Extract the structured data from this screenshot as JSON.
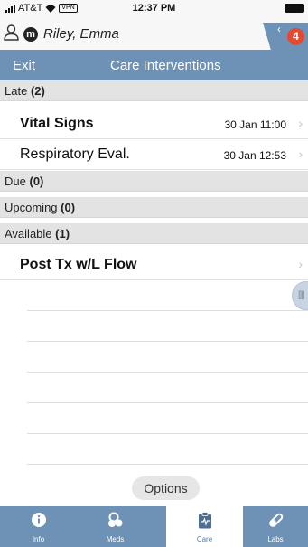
{
  "status_bar": {
    "carrier": "AT&T",
    "vpn": "VPN",
    "time": "12:37 PM"
  },
  "patient": {
    "initial": "m",
    "name": "Riley, Emma",
    "alert_count": "4"
  },
  "nav": {
    "exit_label": "Exit",
    "title": "Care Interventions"
  },
  "sections": {
    "late": {
      "label": "Late",
      "count": "(2)"
    },
    "due": {
      "label": "Due",
      "count": "(0)"
    },
    "upcoming": {
      "label": "Upcoming",
      "count": "(0)"
    },
    "available": {
      "label": "Available",
      "count": "(1)"
    }
  },
  "late_items": [
    {
      "name": "Vital Signs",
      "date": "30 Jan 11:00"
    },
    {
      "name": "Respiratory Eval.",
      "date": "30 Jan 12:53"
    }
  ],
  "available_items": [
    {
      "name": "Post Tx w/L Flow"
    }
  ],
  "options_label": "Options",
  "tabs": [
    {
      "label": "Info",
      "icon": "info-icon"
    },
    {
      "label": "Meds",
      "icon": "pills-icon"
    },
    {
      "label": "Care",
      "icon": "clipboard-icon"
    },
    {
      "label": "Labs",
      "icon": "test-tube-icon"
    }
  ],
  "colors": {
    "accent": "#6e92b6",
    "badge": "#e34a2f",
    "section_bg": "#e3e3e3"
  }
}
